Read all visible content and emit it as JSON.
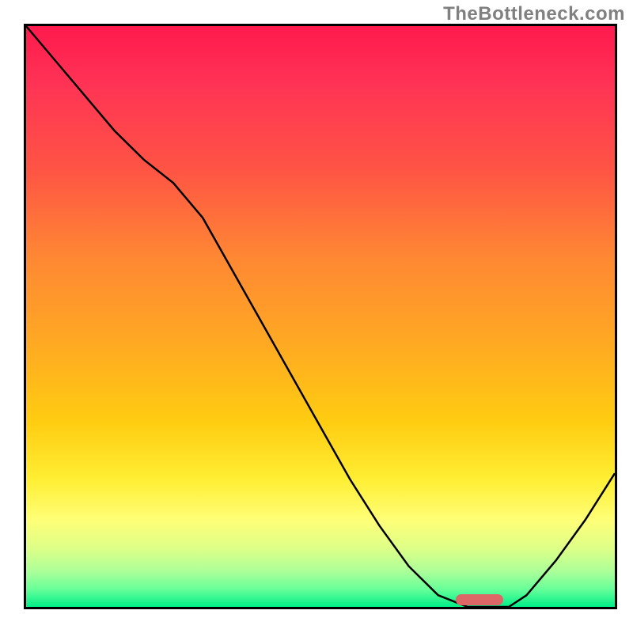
{
  "watermark": "TheBottleneck.com",
  "chart_data": {
    "type": "line",
    "title": "",
    "xlabel": "",
    "ylabel": "",
    "x": [
      0,
      5,
      10,
      15,
      20,
      25,
      30,
      35,
      40,
      45,
      50,
      55,
      60,
      65,
      70,
      75,
      78,
      82,
      85,
      90,
      95,
      100
    ],
    "values": [
      100,
      94,
      88,
      82,
      77,
      73,
      67,
      58,
      49,
      40,
      31,
      22,
      14,
      7,
      2,
      0,
      0,
      0,
      2,
      8,
      15,
      23
    ],
    "xlim": [
      0,
      100
    ],
    "ylim": [
      0,
      100
    ],
    "marker": {
      "x_center": 77,
      "y": 0,
      "width": 8
    },
    "gradient_stops": [
      {
        "pos": 0,
        "color": "#ff1a4d"
      },
      {
        "pos": 50,
        "color": "#ffaa22"
      },
      {
        "pos": 85,
        "color": "#ffff77"
      },
      {
        "pos": 100,
        "color": "#00ee88"
      }
    ]
  }
}
